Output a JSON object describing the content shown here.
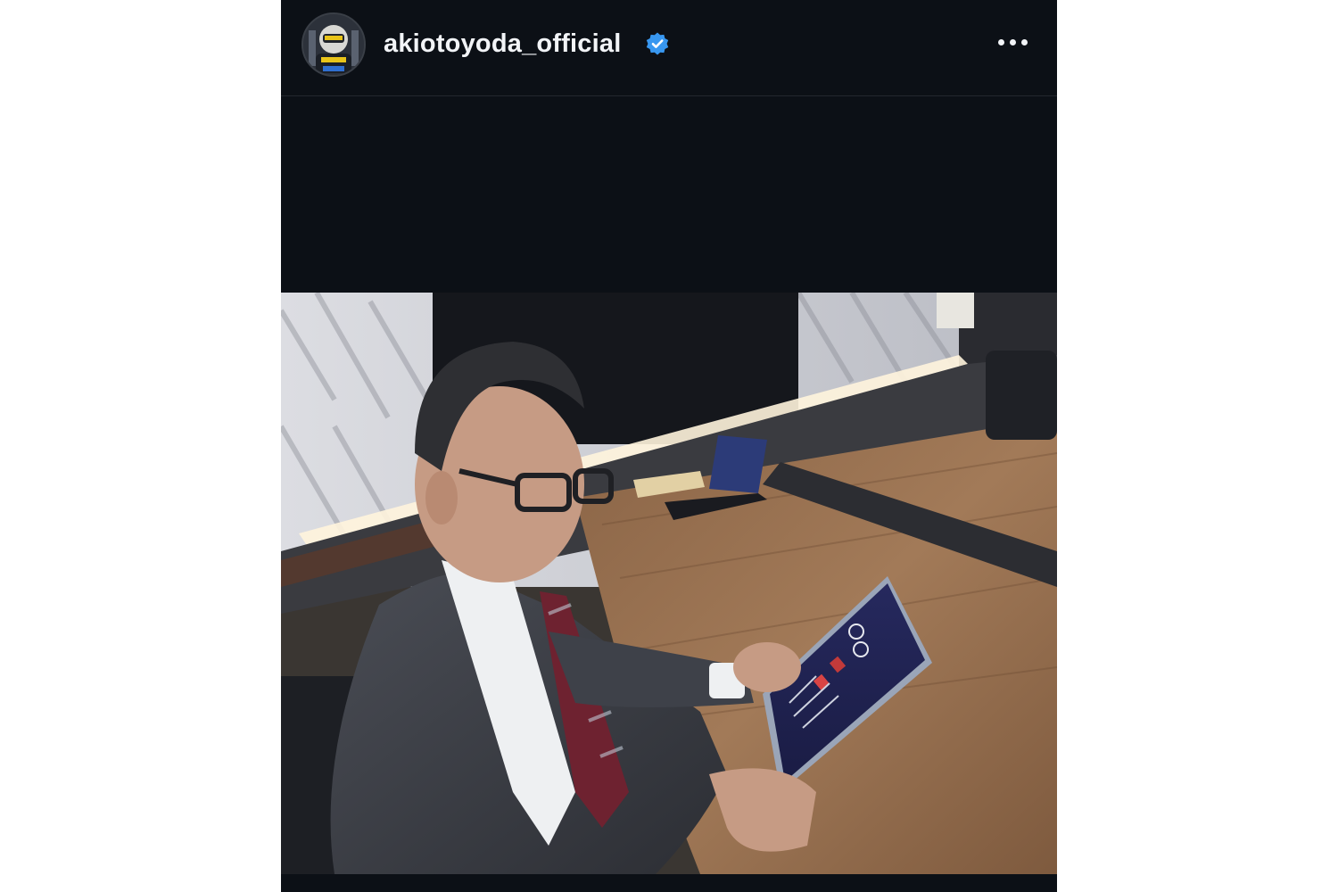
{
  "post": {
    "author": {
      "username": "akiotoyoda_official",
      "verified": true,
      "avatar": "profile-photo"
    },
    "more_icon": "more-horizontal-icon",
    "verified_icon": "verified-badge-icon",
    "photo": {}
  },
  "colors": {
    "background": "#0c1016",
    "text": "#f2f4f7",
    "verified_blue": "#3897f0"
  }
}
